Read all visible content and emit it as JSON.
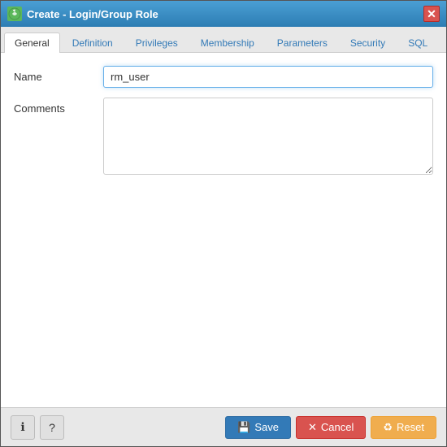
{
  "window": {
    "title": "Create - Login/Group Role",
    "icon_label": "♻",
    "close_label": "✕"
  },
  "tabs": [
    {
      "id": "general",
      "label": "General",
      "active": true
    },
    {
      "id": "definition",
      "label": "Definition",
      "active": false
    },
    {
      "id": "privileges",
      "label": "Privileges",
      "active": false
    },
    {
      "id": "membership",
      "label": "Membership",
      "active": false
    },
    {
      "id": "parameters",
      "label": "Parameters",
      "active": false
    },
    {
      "id": "security",
      "label": "Security",
      "active": false
    },
    {
      "id": "sql",
      "label": "SQL",
      "active": false
    }
  ],
  "form": {
    "name_label": "Name",
    "name_value": "rm_user",
    "comments_label": "Comments",
    "comments_value": "",
    "name_placeholder": "",
    "comments_placeholder": ""
  },
  "footer": {
    "info_icon": "ℹ",
    "help_icon": "?",
    "save_label": "Save",
    "cancel_label": "Cancel",
    "reset_label": "Reset",
    "save_icon": "💾",
    "cancel_icon": "✕",
    "reset_icon": "♻"
  }
}
